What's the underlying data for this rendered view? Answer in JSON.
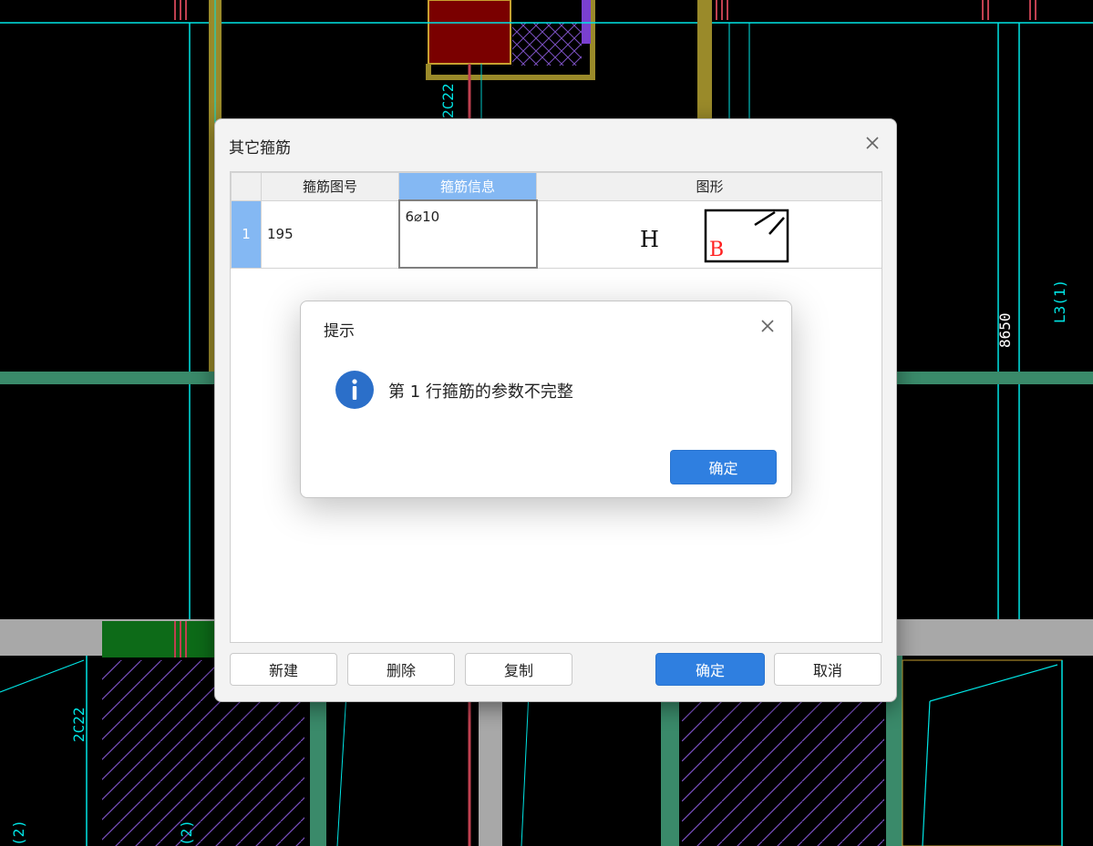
{
  "background_cad": {
    "labels": [
      "2C22",
      "2C22",
      "8650",
      "L3(1)",
      "(2)",
      "(2)"
    ]
  },
  "main_dialog": {
    "title": "其它箍筋",
    "columns": [
      "箍筋图号",
      "箍筋信息",
      "图形"
    ],
    "rows": [
      {
        "index": "1",
        "figure_no": "195",
        "info": "6⌀10",
        "shape_label_h": "H",
        "shape_label_b": "B"
      }
    ],
    "buttons": {
      "new": "新建",
      "delete": "删除",
      "copy": "复制",
      "ok": "确定",
      "cancel": "取消"
    }
  },
  "message_box": {
    "title": "提示",
    "message": "第 1 行箍筋的参数不完整",
    "ok": "确定",
    "icon": "info-icon"
  },
  "colors": {
    "accent": "#2f7fe0",
    "header_selected": "#84b8f3",
    "cad_cyan": "#00e5e5",
    "cad_green": "#3a8a6a"
  }
}
